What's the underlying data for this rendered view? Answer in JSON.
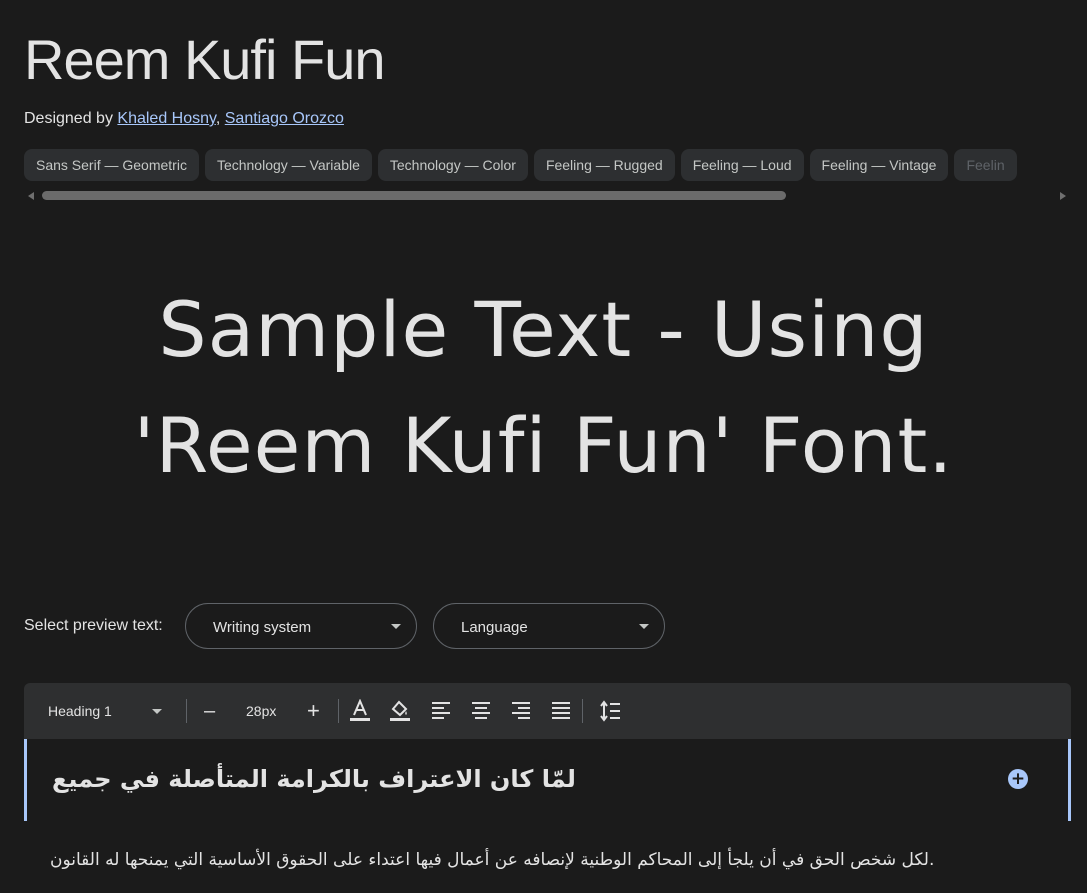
{
  "header": {
    "title": "Reem Kufi Fun",
    "designed_by_prefix": "Designed by",
    "designers": [
      "Khaled Hosny",
      "Santiago Orozco"
    ],
    "separator": ","
  },
  "tags": [
    "Sans Serif — Geometric",
    "Technology — Variable",
    "Technology — Color",
    "Feeling — Rugged",
    "Feeling — Loud",
    "Feeling — Vintage",
    "Feelin"
  ],
  "sample_text": "Sample Text - Using 'Reem Kufi Fun' Font.",
  "preview": {
    "label": "Select preview text:",
    "writing_system": "Writing system",
    "language": "Language"
  },
  "toolbar": {
    "style_select": "Heading 1",
    "minus": "–",
    "font_size": "28px",
    "plus": "+"
  },
  "editor": {
    "heading": "لمّا كان الاعتراف بالكرامة المتأصلة في جميع",
    "paragraph": ".لكل شخص الحق في أن يلجأ إلى المحاكم الوطنية لإنصافه عن أعمال فيها اعتداء على الحقوق الأساسية التي يمنحها له القانون"
  },
  "colors": {
    "background": "#1b1b1b",
    "accent": "#a8c7fa",
    "chip": "#2d2f31",
    "toolbar": "#2e2f30"
  }
}
